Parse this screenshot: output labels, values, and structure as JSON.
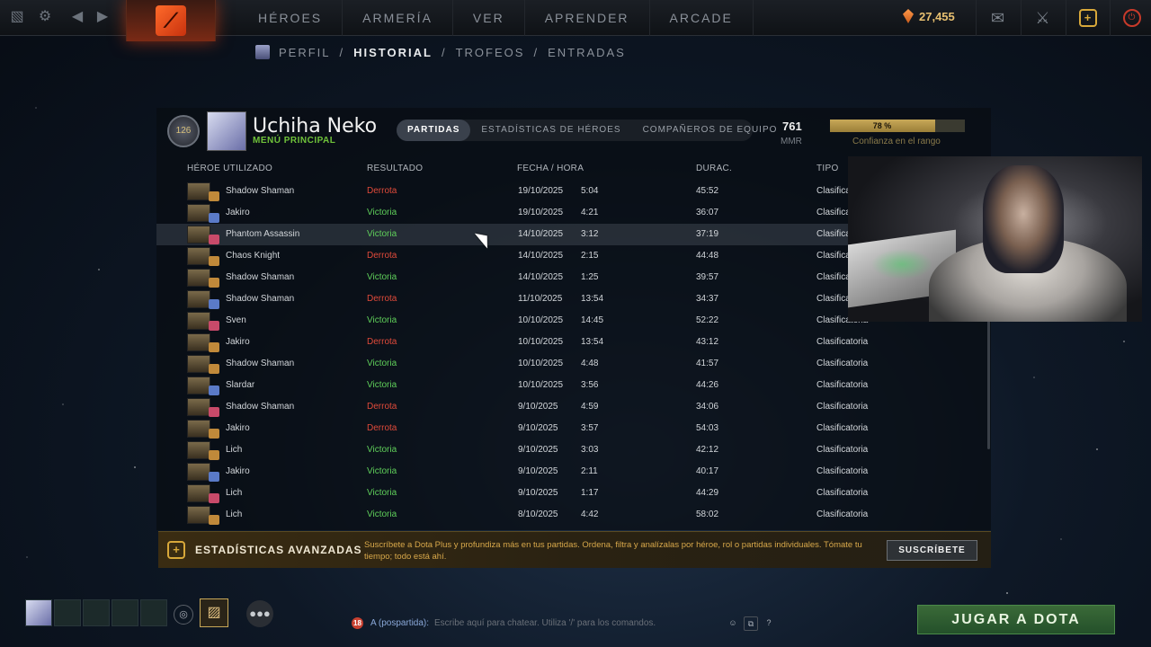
{
  "topbar": {
    "nav": [
      "HÉROES",
      "ARMERÍA",
      "VER",
      "APRENDER",
      "ARCADE"
    ],
    "currency": "27,455"
  },
  "breadcrumb": [
    "PERFIL",
    "HISTORIAL",
    "TROFEOS",
    "ENTRADAS"
  ],
  "profile": {
    "name": "Uchiha Neko",
    "subtitle": "MENÚ PRINCIPAL",
    "badge": "126",
    "tabs": [
      "PARTIDAS",
      "ESTADÍSTICAS DE HÉROES",
      "COMPAÑEROS DE EQUIPO"
    ],
    "mmr_value": "761",
    "mmr_label": "MMR",
    "confidence_pct": "78 %",
    "confidence_fraction": 0.78,
    "confidence_label": "Confianza en el rango"
  },
  "columns": {
    "hero": "HÉROE UTILIZADO",
    "result": "RESULTADO",
    "datetime": "FECHA / HORA",
    "duration": "DURAC.",
    "type": "TIPO"
  },
  "matches": [
    {
      "hero": "Shadow Shaman",
      "result": "Derrota",
      "date": "19/10/2025",
      "time": "5:04",
      "duration": "45:52",
      "type": "Clasificatoria"
    },
    {
      "hero": "Jakiro",
      "result": "Victoria",
      "date": "19/10/2025",
      "time": "4:21",
      "duration": "36:07",
      "type": "Clasificatoria"
    },
    {
      "hero": "Phantom Assassin",
      "result": "Victoria",
      "date": "14/10/2025",
      "time": "3:12",
      "duration": "37:19",
      "type": "Clasificatoria"
    },
    {
      "hero": "Chaos Knight",
      "result": "Derrota",
      "date": "14/10/2025",
      "time": "2:15",
      "duration": "44:48",
      "type": "Clasificatoria"
    },
    {
      "hero": "Shadow Shaman",
      "result": "Victoria",
      "date": "14/10/2025",
      "time": "1:25",
      "duration": "39:57",
      "type": "Clasificatoria"
    },
    {
      "hero": "Shadow Shaman",
      "result": "Derrota",
      "date": "11/10/2025",
      "time": "13:54",
      "duration": "34:37",
      "type": "Clasificatoria"
    },
    {
      "hero": "Sven",
      "result": "Victoria",
      "date": "10/10/2025",
      "time": "14:45",
      "duration": "52:22",
      "type": "Clasificatoria"
    },
    {
      "hero": "Jakiro",
      "result": "Derrota",
      "date": "10/10/2025",
      "time": "13:54",
      "duration": "43:12",
      "type": "Clasificatoria"
    },
    {
      "hero": "Shadow Shaman",
      "result": "Victoria",
      "date": "10/10/2025",
      "time": "4:48",
      "duration": "41:57",
      "type": "Clasificatoria"
    },
    {
      "hero": "Slardar",
      "result": "Victoria",
      "date": "10/10/2025",
      "time": "3:56",
      "duration": "44:26",
      "type": "Clasificatoria"
    },
    {
      "hero": "Shadow Shaman",
      "result": "Derrota",
      "date": "9/10/2025",
      "time": "4:59",
      "duration": "34:06",
      "type": "Clasificatoria"
    },
    {
      "hero": "Jakiro",
      "result": "Derrota",
      "date": "9/10/2025",
      "time": "3:57",
      "duration": "54:03",
      "type": "Clasificatoria"
    },
    {
      "hero": "Lich",
      "result": "Victoria",
      "date": "9/10/2025",
      "time": "3:03",
      "duration": "42:12",
      "type": "Clasificatoria"
    },
    {
      "hero": "Jakiro",
      "result": "Victoria",
      "date": "9/10/2025",
      "time": "2:11",
      "duration": "40:17",
      "type": "Clasificatoria"
    },
    {
      "hero": "Lich",
      "result": "Victoria",
      "date": "9/10/2025",
      "time": "1:17",
      "duration": "44:29",
      "type": "Clasificatoria"
    },
    {
      "hero": "Lich",
      "result": "Victoria",
      "date": "8/10/2025",
      "time": "4:42",
      "duration": "58:02",
      "type": "Clasificatoria"
    }
  ],
  "dota_plus": {
    "title": "ESTADÍSTICAS AVANZADAS",
    "text": "Suscríbete a Dota Plus y profundiza más en tus partidas. Ordena, filtra y analízalas por héroe, rol o partidas individuales. Tómate tu tiempo; todo está ahí.",
    "button": "SUSCRÍBETE"
  },
  "chat": {
    "unread": "18",
    "channel": "A (pospartida):",
    "placeholder": "Escribe aquí para chatear. Utiliza '/' para los comandos."
  },
  "play_button": "JUGAR A DOTA"
}
